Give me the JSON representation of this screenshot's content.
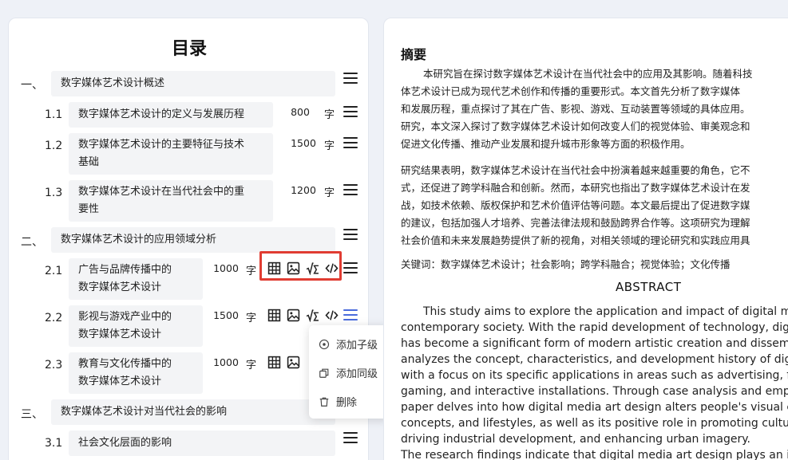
{
  "toc": {
    "title": "目录",
    "unit": "字",
    "sections": [
      {
        "num": "一、",
        "title": "数字媒体艺术设计概述"
      },
      {
        "num": "1.1",
        "title": "数字媒体艺术设计的定义与发展历程",
        "words": "800"
      },
      {
        "num": "1.2",
        "title_l1": "数字媒体艺术设计的主要特征与技术",
        "title_l2": "基础",
        "words": "1500"
      },
      {
        "num": "1.3",
        "title_l1": "数字媒体艺术设计在当代社会中的重",
        "title_l2": "要性",
        "words": "1200"
      },
      {
        "num": "二、",
        "title": "数字媒体艺术设计的应用领域分析"
      },
      {
        "num": "2.1",
        "title_l1": "广告与品牌传播中的",
        "title_l2": "数字媒体艺术设计",
        "words": "1000"
      },
      {
        "num": "2.2",
        "title_l1": "影视与游戏产业中的",
        "title_l2": "数字媒体艺术设计",
        "words": "1500"
      },
      {
        "num": "2.3",
        "title_l1": "教育与文化传播中的",
        "title_l2": "数字媒体艺术设计",
        "words": "1000"
      },
      {
        "num": "三、",
        "title": "数字媒体艺术设计对当代社会的影响"
      },
      {
        "num": "3.1",
        "title": "社会文化层面的影响"
      }
    ],
    "toolbar_icons": [
      "table-icon",
      "image-icon",
      "formula-icon",
      "code-icon"
    ]
  },
  "context_menu": {
    "add_child": "添加子级",
    "add_sibling": "添加同级",
    "delete": "删除"
  },
  "abstract": {
    "heading": "摘要",
    "p1": [
      "本研究旨在探讨数字媒体艺术设计在当代社会中的应用及其影响。随着科技",
      "体艺术设计已成为现代艺术创作和传播的重要形式。本文首先分析了数字媒体",
      "和发展历程，重点探讨了其在广告、影视、游戏、互动装置等领域的具体应用。",
      "研究，本文深入探讨了数字媒体艺术设计如何改变人们的视觉体验、审美观念和",
      "促进文化传播、推动产业发展和提升城市形象等方面的积极作用。"
    ],
    "p2": [
      "研究结果表明，数字媒体艺术设计在当代社会中扮演着越来越重要的角色，它不",
      "式，还促进了跨学科融合和创新。然而，本研究也指出了数字媒体艺术设计在发",
      "战，如技术依赖、版权保护和艺术价值评估等问题。本文最后提出了促进数字媒",
      "的建议，包括加强人才培养、完善法律法规和鼓励跨界合作等。这项研究为理解",
      "社会价值和未来发展趋势提供了新的视角，对相关领域的理论研究和实践应用具"
    ],
    "keywords": "关键词：数字媒体艺术设计；社会影响；跨学科融合；视觉体验；文化传播",
    "en_title": "ABSTRACT",
    "en_lines": [
      "This study aims to explore the application and impact of digital medi",
      "contemporary society. With the rapid development of technology, digital",
      "has become a significant form of modern artistic creation and disseminat",
      "analyzes the concept, characteristics, and development history of digital",
      "with a focus on its specific applications in areas such as advertising, film",
      "gaming, and interactive installations. Through case analysis and empirica",
      "paper delves into how digital media art design alters people's visual expe",
      "concepts, and lifestyles, as well as its positive role in promoting cultural c",
      "driving industrial development, and enhancing urban imagery.",
      "The research findings indicate that digital media art design plays an incre"
    ]
  },
  "colors": {
    "highlight": "#e03c32",
    "active_menu": "#4a6bdc",
    "title_bg": "#f3f4f6"
  }
}
